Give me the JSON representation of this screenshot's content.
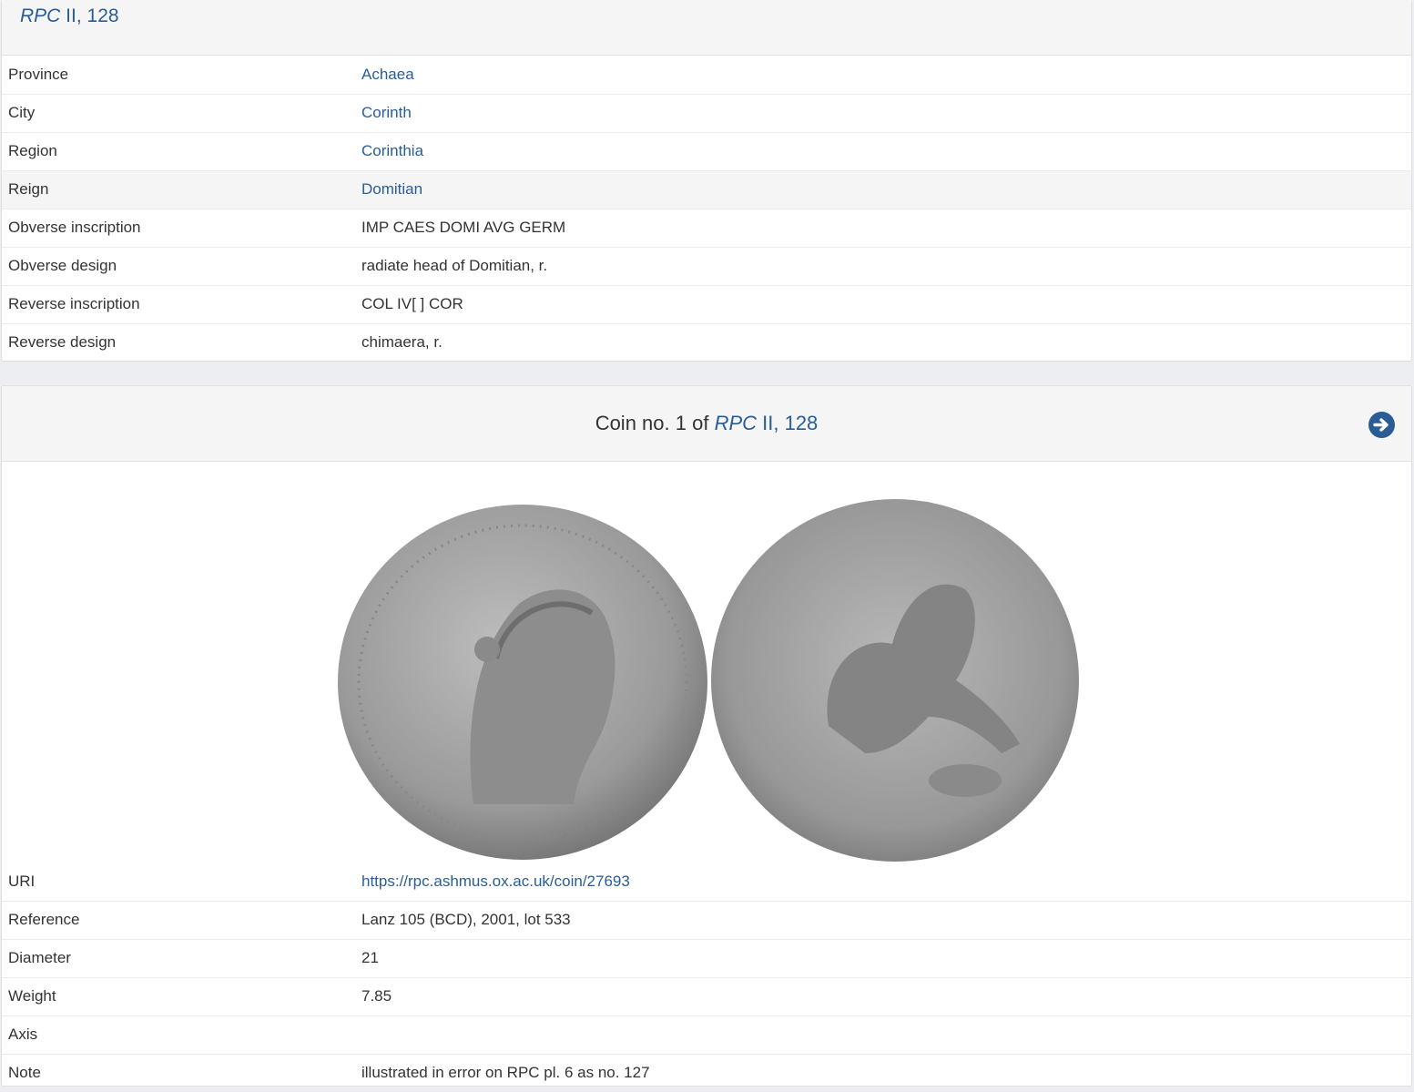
{
  "type_panel": {
    "title_italic": "RPC",
    "title_rest": " II, 128",
    "rows": [
      {
        "label": "Province",
        "value": "Achaea",
        "link": true
      },
      {
        "label": "City",
        "value": "Corinth",
        "link": true
      },
      {
        "label": "Region",
        "value": "Corinthia",
        "link": true
      },
      {
        "label": "Reign",
        "value": "Domitian",
        "link": true
      },
      {
        "label": "Obverse inscription",
        "value": "IMP CAES DOMI AVG GERM",
        "link": false
      },
      {
        "label": "Obverse design",
        "value": "radiate head of Domitian, r.",
        "link": false
      },
      {
        "label": "Reverse inscription",
        "value": "COL IV[ ] COR",
        "link": false
      },
      {
        "label": "Reverse design",
        "value": "chimaera, r.",
        "link": false
      }
    ]
  },
  "coin_panel": {
    "title_prefix": "Coin no. 1 of ",
    "title_italic": "RPC",
    "title_rest": " II, 128",
    "next_icon": "circle-arrow-right-icon",
    "rows": [
      {
        "label": "URI",
        "value": "https://rpc.ashmus.ox.ac.uk/coin/27693",
        "link": true
      },
      {
        "label": "Reference",
        "value": "Lanz 105 (BCD), 2001, lot 533",
        "link": false
      },
      {
        "label": "Diameter",
        "value": "21",
        "link": false
      },
      {
        "label": "Weight",
        "value": "7.85",
        "link": false
      },
      {
        "label": "Axis",
        "value": "",
        "link": false
      },
      {
        "label": "Note",
        "value": "illustrated in error on RPC pl. 6 as no. 127",
        "link": false
      }
    ]
  },
  "colors": {
    "link": "#2a5d96",
    "header_bg": "#f5f5f5",
    "page_bg": "#eceef1"
  }
}
